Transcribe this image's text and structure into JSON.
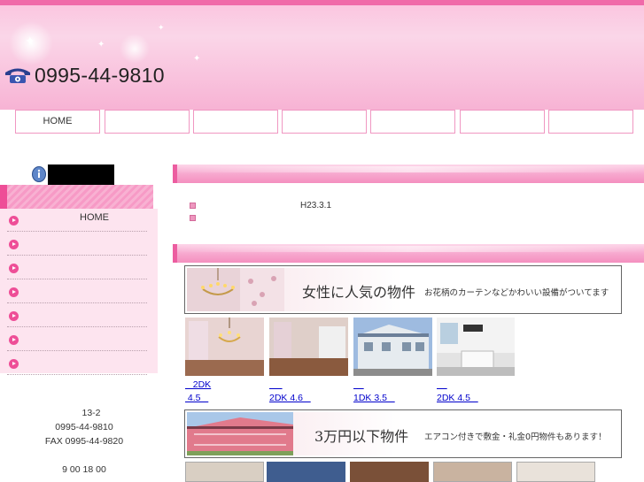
{
  "header": {
    "phone": "0995-44-9810",
    "phone_icon": "telephone-icon",
    "colors": {
      "top_stripe": "#f06aa9",
      "header_bg": "#fad6e8",
      "accent": "#ee4e97"
    }
  },
  "nav": {
    "items": [
      {
        "label": "HOME"
      },
      {
        "label": ""
      },
      {
        "label": ""
      },
      {
        "label": ""
      },
      {
        "label": ""
      },
      {
        "label": ""
      },
      {
        "label": ""
      }
    ]
  },
  "sidebar": {
    "info_icon": "info-icon",
    "menu": [
      {
        "label": "HOME"
      },
      {
        "label": ""
      },
      {
        "label": ""
      },
      {
        "label": ""
      },
      {
        "label": ""
      },
      {
        "label": ""
      },
      {
        "label": ""
      }
    ],
    "address": {
      "line1": "13-2",
      "tel": "0995-44-9810",
      "fax": "FAX 0995-44-9820",
      "hours": "9 00 18 00"
    }
  },
  "news": {
    "items": [
      {
        "date": "H23.3.1"
      },
      {
        "date": ""
      }
    ]
  },
  "banners": [
    {
      "title": "女性に人気の物件",
      "subtitle": "お花柄のカーテンなどかわいい設備がついてます"
    },
    {
      "title": "3万円以下物件",
      "subtitle": "エアコン付きで敷金・礼金0円物件もあります！"
    }
  ],
  "listings": [
    {
      "line1": "   2DK",
      "line2": " 4.5   "
    },
    {
      "line1": "     ",
      "line2": "2DK 4.6   "
    },
    {
      "line1": "    ",
      "line2": "1DK 3.5   "
    },
    {
      "line1": "    ",
      "line2": "2DK 4.5   "
    }
  ]
}
